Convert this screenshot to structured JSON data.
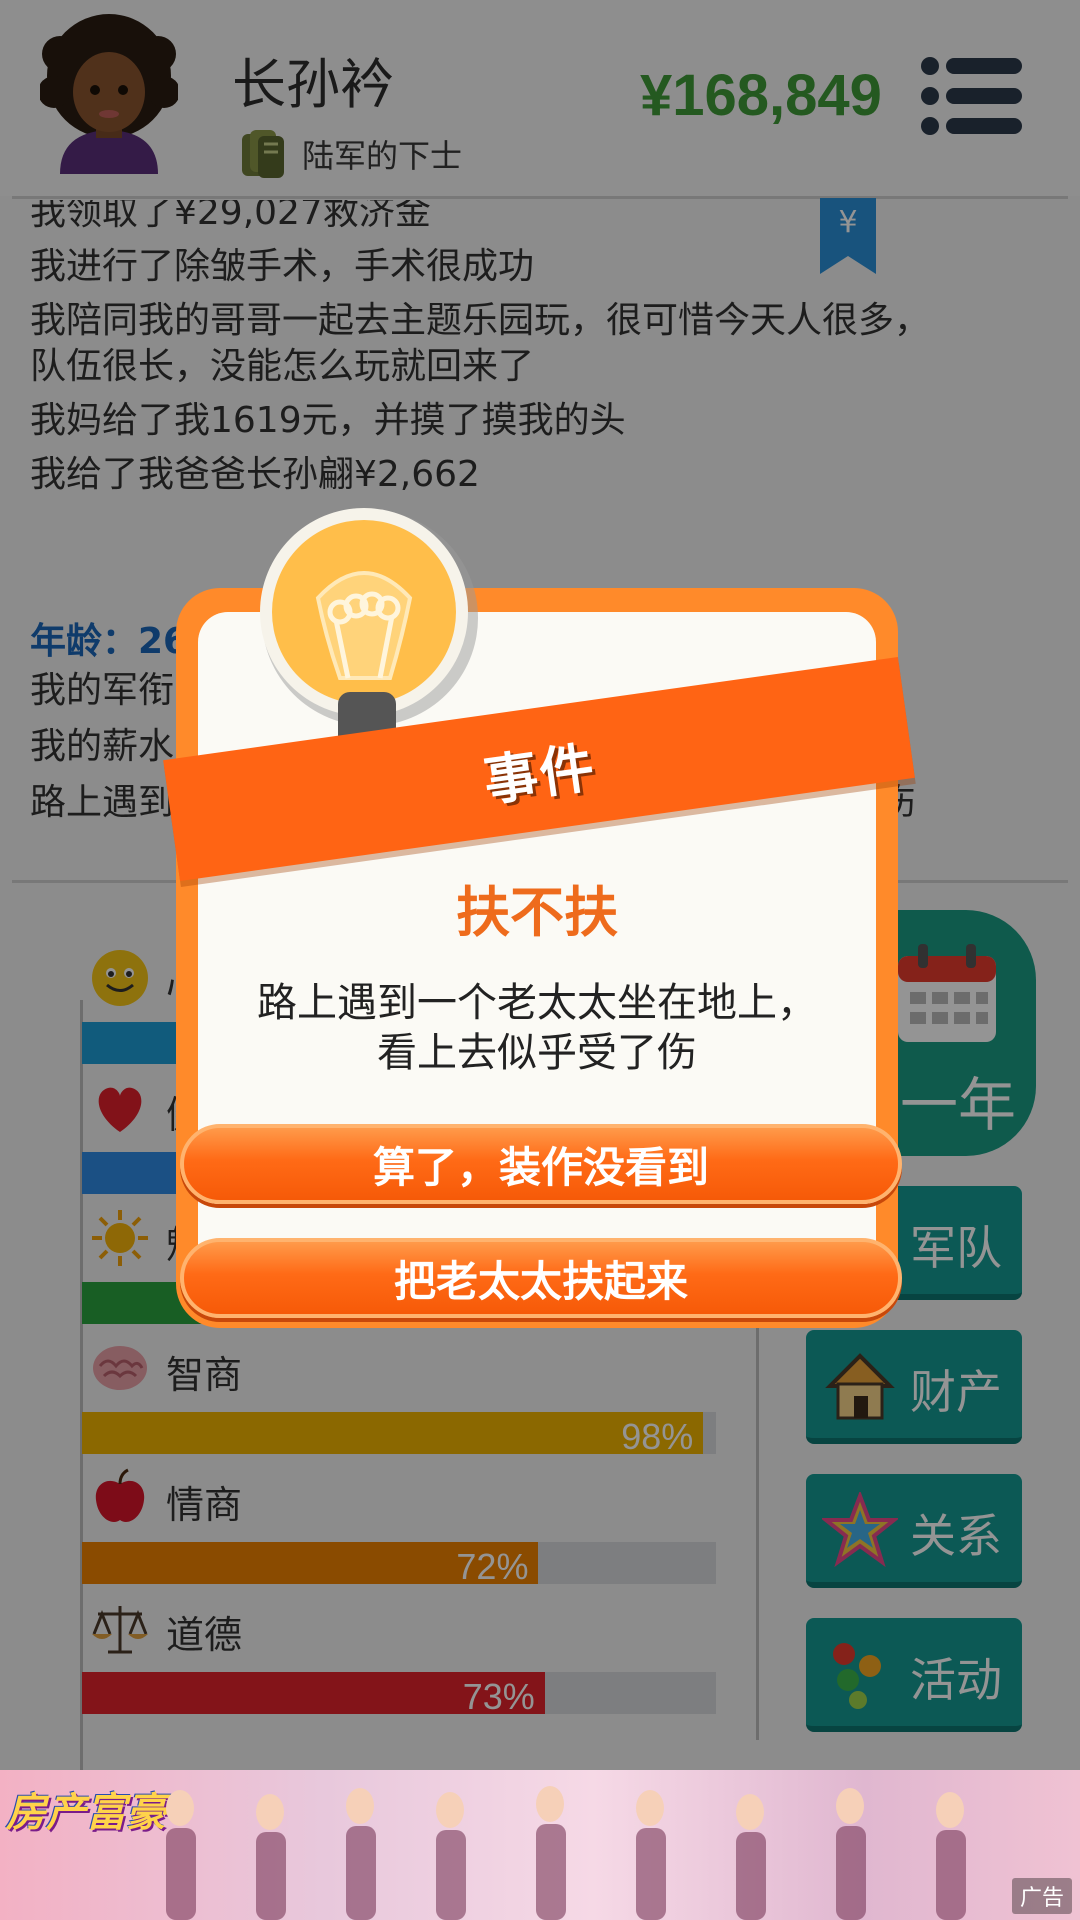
{
  "header": {
    "player_name": "长孙衿",
    "rank": "陆军的下士",
    "money": "¥168,849"
  },
  "log": {
    "lines_top": [
      "我领取了¥29,027救济金",
      "我进行了除皱手术，手术很成功",
      "我陪同我的哥哥一起去主题乐园玩，很可惜今天人很多，",
      "队伍很长，没能怎么玩就回来了",
      "我妈给了我1619元，并摸了摸我的头",
      "我给了我爸爸长孙翩¥2,662"
    ],
    "age_label": "年龄：26",
    "lines_bottom": [
      "我的军衔",
      "我的薪水",
      "路上遇到"
    ],
    "truncated_tail": "伤",
    "bookmark_symbol": "¥"
  },
  "stats": [
    {
      "label": "心",
      "percent": 100,
      "pct_text": "",
      "color": "#1e9ed6",
      "icon": "smiley-icon"
    },
    {
      "label": "健",
      "percent": 100,
      "pct_text": "",
      "color": "#2f8be4",
      "icon": "heart-icon"
    },
    {
      "label": "魅",
      "percent": 100,
      "pct_text": "",
      "color": "#2aa33f",
      "icon": "sun-icon"
    },
    {
      "label": "智商",
      "percent": 98,
      "pct_text": "98%",
      "color": "#f0b400",
      "icon": "brain-icon"
    },
    {
      "label": "情商",
      "percent": 72,
      "pct_text": "72%",
      "color": "#ee8200",
      "icon": "apple-icon"
    },
    {
      "label": "道德",
      "percent": 73,
      "pct_text": "73%",
      "color": "#e2232b",
      "icon": "scales-icon"
    }
  ],
  "side_buttons": {
    "age_up": "一年",
    "army": "军队",
    "property": "财产",
    "relations": "关系",
    "activities": "活动"
  },
  "dialog": {
    "ribbon": "事件",
    "title": "扶不扶",
    "description_line1": "路上遇到一个老太太坐在地上，",
    "description_line2": "看上去似乎受了伤",
    "choice_1": "算了，装作没看到",
    "choice_2": "把老太太扶起来"
  },
  "ad": {
    "logo": "房产富豪",
    "tag": "广告"
  }
}
